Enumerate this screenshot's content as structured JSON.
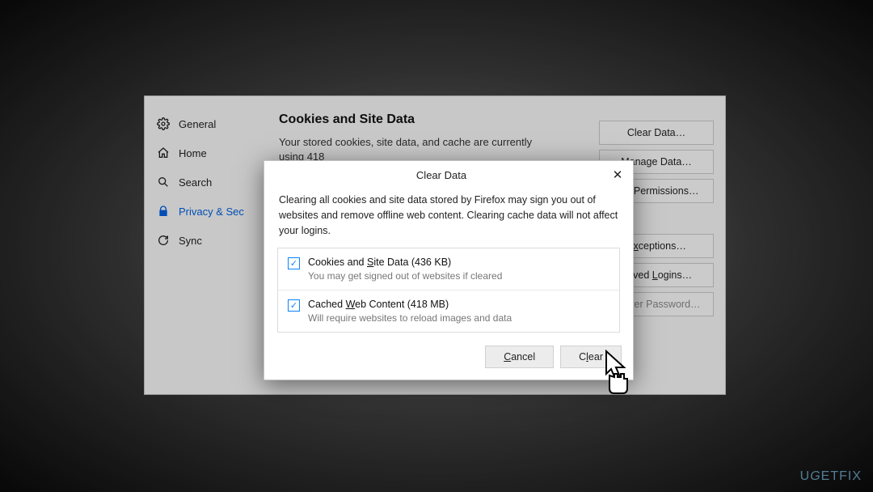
{
  "sidebar": {
    "items": [
      {
        "label": "General"
      },
      {
        "label": "Home"
      },
      {
        "label": "Search"
      },
      {
        "label": "Privacy & Sec"
      },
      {
        "label": "Sync"
      }
    ]
  },
  "main": {
    "section_title": "Cookies and Site Data",
    "section_desc": "Your stored cookies, site data, and cache are currently using 418",
    "buttons": {
      "clear_data": "Clear Data…",
      "manage_data": "Manage Data…",
      "manage_permissions": "age Permissions…",
      "exceptions": "Exceptions…",
      "saved_logins": "Saved Logins…",
      "master_password": "Master Password…"
    }
  },
  "dialog": {
    "title": "Clear Data",
    "close": "✕",
    "message": "Clearing all cookies and site data stored by Firefox may sign you out of websites and remove offline web content. Clearing cache data will not affect your logins.",
    "options": [
      {
        "label_pre": "Cookies and ",
        "label_mnemonic": "S",
        "label_post": "ite Data (436 KB)",
        "sub": "You may get signed out of websites if cleared",
        "checked": true
      },
      {
        "label_pre": "Cached ",
        "label_mnemonic": "W",
        "label_post": "eb Content (418 MB)",
        "sub": "Will require websites to reload images and data",
        "checked": true
      }
    ],
    "cancel_pre": "",
    "cancel_mnemonic": "C",
    "cancel_post": "ancel",
    "clear_pre": "C",
    "clear_mnemonic": "l",
    "clear_post": "ear"
  },
  "watermark": {
    "text_a": "U",
    "text_b": "G",
    "text_c": "ETFIX"
  }
}
